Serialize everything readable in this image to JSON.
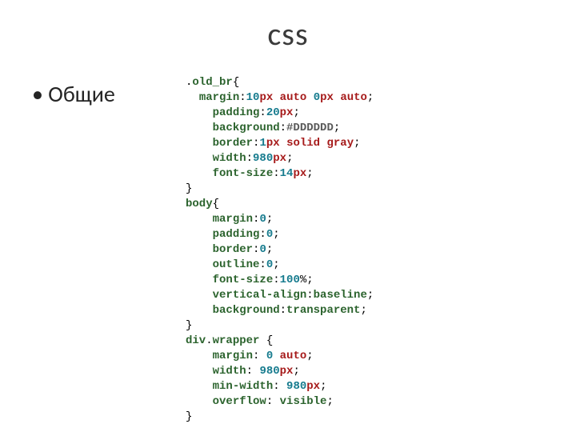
{
  "slide": {
    "title": "css",
    "bullet": "Общие"
  },
  "code": {
    "rules": [
      {
        "selector": {
          "prefix": ".",
          "name": "old_br"
        },
        "indent_prop": "  ",
        "indent_rest": "    ",
        "decls": [
          {
            "prop": "margin",
            "indent": "  ",
            "parts": [
              {
                "t": "num",
                "v": "10"
              },
              {
                "t": "unit",
                "v": "px"
              },
              {
                "t": "txt",
                "v": " "
              },
              {
                "t": "kw",
                "v": "auto"
              },
              {
                "t": "txt",
                "v": " "
              },
              {
                "t": "num",
                "v": "0"
              },
              {
                "t": "unit",
                "v": "px"
              },
              {
                "t": "txt",
                "v": " "
              },
              {
                "t": "kw",
                "v": "auto"
              }
            ]
          },
          {
            "prop": "padding",
            "indent": "    ",
            "parts": [
              {
                "t": "num",
                "v": "20"
              },
              {
                "t": "unit",
                "v": "px"
              }
            ]
          },
          {
            "prop": "background",
            "indent": "    ",
            "parts": [
              {
                "t": "hex",
                "v": "#DDDDDD"
              }
            ]
          },
          {
            "prop": "border",
            "indent": "    ",
            "parts": [
              {
                "t": "num",
                "v": "1"
              },
              {
                "t": "unit",
                "v": "px"
              },
              {
                "t": "txt",
                "v": " "
              },
              {
                "t": "kw",
                "v": "solid"
              },
              {
                "t": "txt",
                "v": " "
              },
              {
                "t": "kw",
                "v": "gray"
              }
            ]
          },
          {
            "prop": "width",
            "indent": "    ",
            "parts": [
              {
                "t": "num",
                "v": "980"
              },
              {
                "t": "unit",
                "v": "px"
              }
            ]
          },
          {
            "prop": "font-size",
            "indent": "    ",
            "parts": [
              {
                "t": "num",
                "v": "14"
              },
              {
                "t": "unit",
                "v": "px"
              }
            ]
          }
        ]
      },
      {
        "selector": {
          "tag": "body"
        },
        "indent_rest": "    ",
        "decls": [
          {
            "prop": "margin",
            "indent": "    ",
            "parts": [
              {
                "t": "num",
                "v": "0"
              }
            ]
          },
          {
            "prop": "padding",
            "indent": "    ",
            "parts": [
              {
                "t": "num",
                "v": "0"
              }
            ]
          },
          {
            "prop": "border",
            "indent": "    ",
            "parts": [
              {
                "t": "num",
                "v": "0"
              }
            ]
          },
          {
            "prop": "outline",
            "indent": "    ",
            "parts": [
              {
                "t": "num",
                "v": "0"
              }
            ]
          },
          {
            "prop": "font-size",
            "indent": "    ",
            "parts": [
              {
                "t": "num",
                "v": "100"
              },
              {
                "t": "punct",
                "v": "%"
              }
            ]
          },
          {
            "prop": "vertical-align",
            "indent": "    ",
            "parts": [
              {
                "t": "val",
                "v": "baseline"
              }
            ]
          },
          {
            "prop": "background",
            "indent": "    ",
            "parts": [
              {
                "t": "val",
                "v": "transparent"
              }
            ]
          }
        ]
      },
      {
        "selector": {
          "tag": "div",
          "prefix": ".",
          "name": "wrapper",
          "space_before_brace": true
        },
        "indent_rest": "    ",
        "sep": ": ",
        "decls": [
          {
            "prop": "margin",
            "indent": "    ",
            "parts": [
              {
                "t": "num",
                "v": "0"
              },
              {
                "t": "txt",
                "v": " "
              },
              {
                "t": "kw",
                "v": "auto"
              }
            ]
          },
          {
            "prop": "width",
            "indent": "    ",
            "parts": [
              {
                "t": "num",
                "v": "980"
              },
              {
                "t": "unit",
                "v": "px"
              }
            ]
          },
          {
            "prop": "min-width",
            "indent": "    ",
            "parts": [
              {
                "t": "num",
                "v": "980"
              },
              {
                "t": "unit",
                "v": "px"
              }
            ]
          },
          {
            "prop": "overflow",
            "indent": "    ",
            "parts": [
              {
                "t": "val",
                "v": "visible"
              }
            ]
          }
        ]
      }
    ]
  }
}
